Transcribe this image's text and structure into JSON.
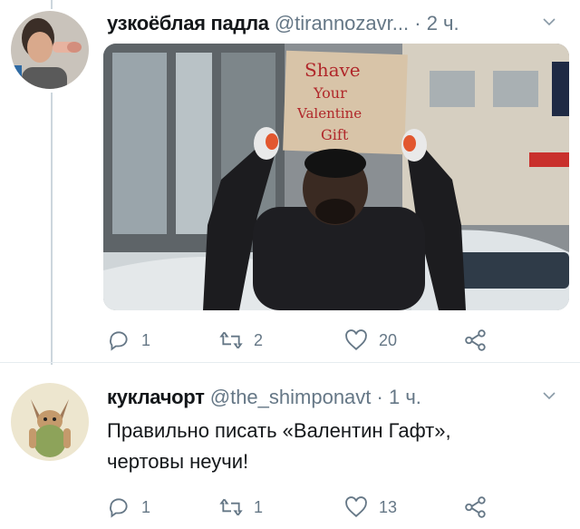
{
  "tweet1": {
    "author_name": "узкоёблая падла",
    "handle": "@tirannozavr...",
    "time": "2 ч.",
    "sign_text": [
      "Shave",
      "Your",
      "Valentine",
      "Gift"
    ],
    "replies": "1",
    "retweets": "2",
    "likes": "20"
  },
  "tweet2": {
    "author_name": "куклачорт",
    "handle": "@the_shimponavt",
    "time": "1 ч.",
    "text_line1": "Правильно писать «Валентин Гафт»,",
    "text_line2": "чертовы неучи!",
    "replies": "1",
    "retweets": "1",
    "likes": "13"
  },
  "separator": "·",
  "colors": {
    "text": "#14171a",
    "secondary": "#657786",
    "divider": "#e6ecf0"
  },
  "icons": [
    "reply-icon",
    "retweet-icon",
    "like-icon",
    "share-icon",
    "chevron-down-icon"
  ]
}
